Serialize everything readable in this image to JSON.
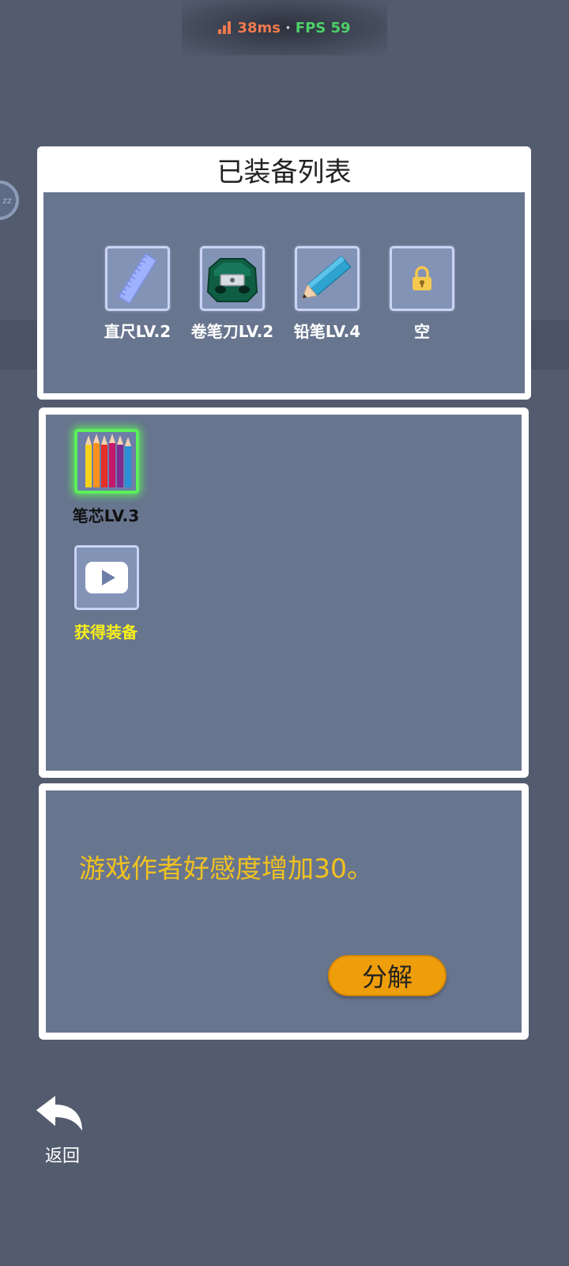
{
  "status_overlay": {
    "ping": "38ms",
    "separator": "·",
    "fps": "FPS 59",
    "ping_color": "#f07a4f",
    "fps_color": "#4ed068"
  },
  "equipped_panel": {
    "title": "已装备列表",
    "slots": [
      {
        "label": "直尺LV.2",
        "icon": "ruler-icon"
      },
      {
        "label": "卷笔刀LV.2",
        "icon": "pencil-sharpener-icon"
      },
      {
        "label": "铅笔LV.4",
        "icon": "pencil-icon"
      },
      {
        "label": "空",
        "icon": "lock-icon"
      }
    ]
  },
  "inventory_panel": {
    "items": [
      {
        "label": "笔芯LV.3",
        "icon": "colored-pencils-icon",
        "selected": true,
        "label_color": "#111111"
      },
      {
        "label": "获得装备",
        "icon": "video-play-icon",
        "selected": false,
        "label_color": "#f6ef1a"
      }
    ]
  },
  "detail_panel": {
    "description": "游戏作者好感度增加30。",
    "decompose_label": "分解",
    "text_color": "#f1c21e",
    "button_color": "#ee9e0a"
  },
  "back": {
    "label": "返回",
    "icon": "back-arrow-icon"
  }
}
